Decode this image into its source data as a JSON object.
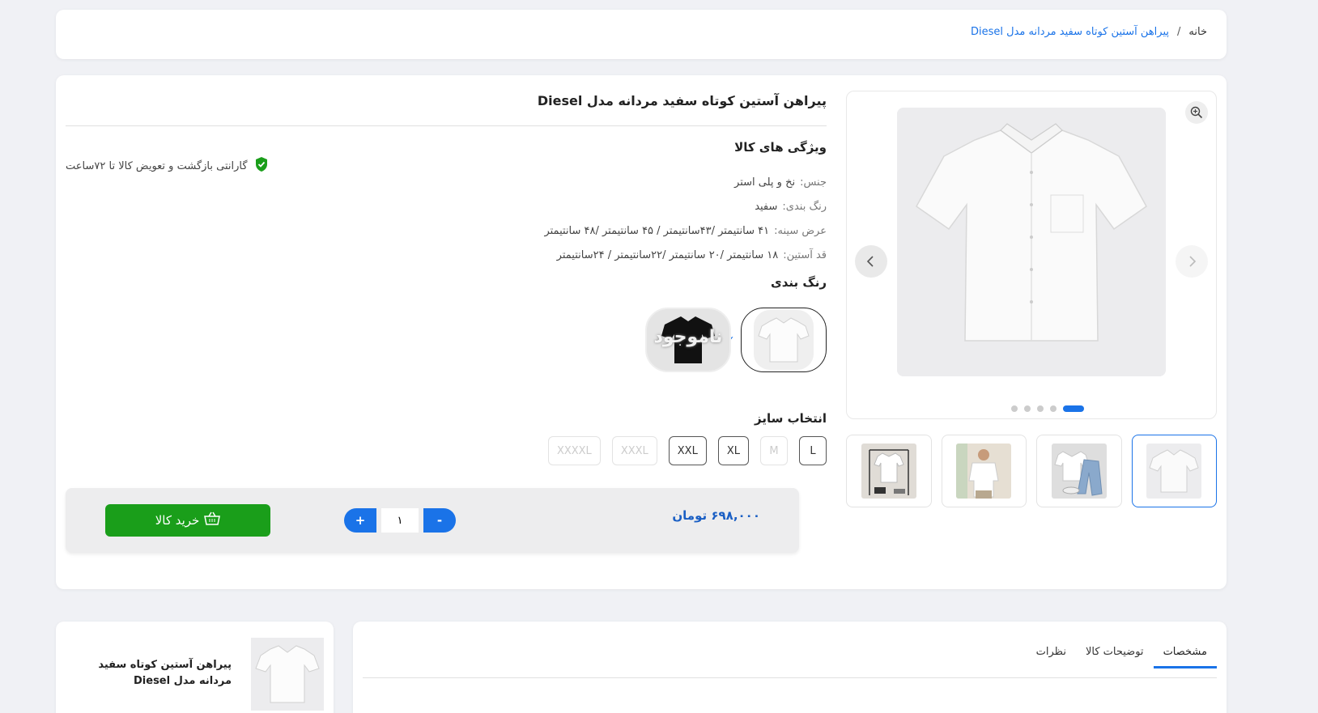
{
  "breadcrumb": {
    "home": "خانه",
    "separator": "/",
    "current": "پیراهن آستین کوتاه سفید مردانه مدل Diesel"
  },
  "product": {
    "title": "پیراهن آستین کوتاه سفید مردانه مدل Diesel",
    "guarantee": "گارانتی بازگشت و تعویض کالا تا ۷۲ساعت",
    "features_title": "ویژگی های کالا",
    "features": [
      {
        "key": "جنس:",
        "value": "نخ و پلی استر"
      },
      {
        "key": "رنگ بندی:",
        "value": "سفید"
      },
      {
        "key": "عرض سینه:",
        "value": "۴۱ سانتیمتر /۴۳سانتیمتر / ۴۵ سانتیمتر /۴۸ سانتیمتر"
      },
      {
        "key": "قد آستین:",
        "value": "۱۸ سانتیمتر /۲۰ سانتیمتر /۲۲سانتیمتر / ۲۴سانتیمتر"
      }
    ],
    "colors_title": "رنگ بندی",
    "colors": [
      {
        "name": "white",
        "selected": true
      },
      {
        "name": "black",
        "selected": false,
        "overlay": "ناموجود"
      }
    ],
    "sizes_title": "انتخاب سایز",
    "sizes": [
      {
        "label": "L",
        "available": true
      },
      {
        "label": "M",
        "available": false
      },
      {
        "label": "XL",
        "available": true
      },
      {
        "label": "XXL",
        "available": true
      },
      {
        "label": "XXXL",
        "available": false
      },
      {
        "label": "XXXXL",
        "available": false
      }
    ],
    "price": "۶۹۸,۰۰۰ تومان",
    "quantity": "۱",
    "plus_label": "+",
    "minus_label": "-",
    "buy_label": "خرید کالا"
  },
  "gallery": {
    "slides_count": 5,
    "active_slide": 0,
    "thumbnails": [
      "shirt-flat",
      "shirt-with-jeans",
      "model-wearing-shirt",
      "shirt-on-rack"
    ]
  },
  "side_product": {
    "title": "پیراهن آستین کوتاه سفید مردانه مدل Diesel"
  },
  "tabs": [
    {
      "label": "مشخصات",
      "active": true
    },
    {
      "label": "توضیحات کالا",
      "active": false
    },
    {
      "label": "نظرات",
      "active": false
    }
  ],
  "colors": {
    "accent": "#1a73e8",
    "buy_green": "#1a9e1a",
    "price_blue": "#1a5fc4"
  }
}
